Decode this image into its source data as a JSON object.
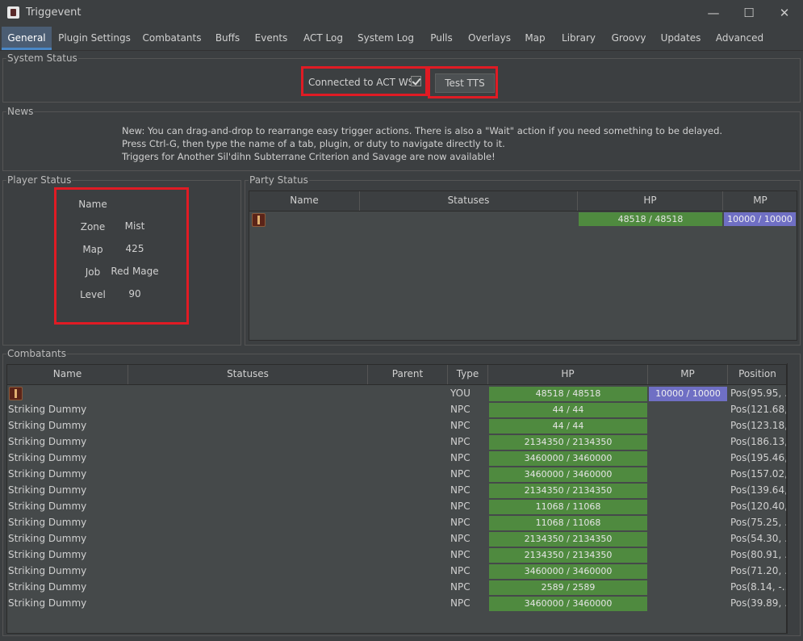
{
  "app": {
    "title": "Triggevent",
    "icon": "app-icon"
  },
  "window_controls": {
    "minimize": "—",
    "maximize": "☐",
    "close": "✕"
  },
  "tabs": [
    "General",
    "Plugin Settings",
    "Combatants",
    "Buffs",
    "Events",
    "ACT Log",
    "System Log",
    "Pulls",
    "Overlays",
    "Map",
    "Library",
    "Groovy",
    "Updates",
    "Advanced"
  ],
  "active_tab": "General",
  "system_status": {
    "title": "System Status",
    "connected_label": "Connected to ACT WS",
    "connected": true,
    "test_tts_label": "Test TTS"
  },
  "news": {
    "title": "News",
    "lines": [
      "New: You can drag-and-drop to rearrange easy trigger actions. There is also a \"Wait\" action if you need something to be delayed.",
      "Press Ctrl-G, then type the name of a tab, plugin, or duty to navigate directly to it.",
      "Triggers for Another Sil'dihn Subterrane Criterion and Savage are now available!"
    ]
  },
  "player_status": {
    "title": "Player Status",
    "rows": [
      {
        "label": "Name",
        "value": ""
      },
      {
        "label": "Zone",
        "value": "Mist"
      },
      {
        "label": "Map",
        "value": "425"
      },
      {
        "label": "Job",
        "value": "Red Mage"
      },
      {
        "label": "Level",
        "value": "90"
      }
    ]
  },
  "party_status": {
    "title": "Party Status",
    "columns": [
      "Name",
      "Statuses",
      "HP",
      "MP"
    ],
    "rows": [
      {
        "name": "",
        "icon": "red-mage-job-icon",
        "statuses": "",
        "hp": "48518 / 48518",
        "hp_fraction": 1.0,
        "mp": "10000 / 10000",
        "mp_fraction": 1.0
      }
    ]
  },
  "combatants": {
    "title": "Combatants",
    "columns": [
      "Name",
      "Statuses",
      "Parent",
      "Type",
      "HP",
      "MP",
      "Position"
    ],
    "rows": [
      {
        "name": "",
        "icon": "red-mage-job-icon",
        "type": "YOU",
        "hp": "48518 / 48518",
        "mp": "10000 / 10000",
        "position": "Pos(95.95, ..."
      },
      {
        "name": "Striking Dummy",
        "type": "NPC",
        "hp": "44 / 44",
        "mp": "",
        "position": "Pos(121.68,..."
      },
      {
        "name": "Striking Dummy",
        "type": "NPC",
        "hp": "44 / 44",
        "mp": "",
        "position": "Pos(123.18,..."
      },
      {
        "name": "Striking Dummy",
        "type": "NPC",
        "hp": "2134350 / 2134350",
        "mp": "",
        "position": "Pos(186.13,..."
      },
      {
        "name": "Striking Dummy",
        "type": "NPC",
        "hp": "3460000 / 3460000",
        "mp": "",
        "position": "Pos(195.46,..."
      },
      {
        "name": "Striking Dummy",
        "type": "NPC",
        "hp": "3460000 / 3460000",
        "mp": "",
        "position": "Pos(157.02,..."
      },
      {
        "name": "Striking Dummy",
        "type": "NPC",
        "hp": "2134350 / 2134350",
        "mp": "",
        "position": "Pos(139.64,..."
      },
      {
        "name": "Striking Dummy",
        "type": "NPC",
        "hp": "11068 / 11068",
        "mp": "",
        "position": "Pos(120.40,..."
      },
      {
        "name": "Striking Dummy",
        "type": "NPC",
        "hp": "11068 / 11068",
        "mp": "",
        "position": "Pos(75.25, ..."
      },
      {
        "name": "Striking Dummy",
        "type": "NPC",
        "hp": "2134350 / 2134350",
        "mp": "",
        "position": "Pos(54.30, ..."
      },
      {
        "name": "Striking Dummy",
        "type": "NPC",
        "hp": "2134350 / 2134350",
        "mp": "",
        "position": "Pos(80.91, ..."
      },
      {
        "name": "Striking Dummy",
        "type": "NPC",
        "hp": "3460000 / 3460000",
        "mp": "",
        "position": "Pos(71.20, ..."
      },
      {
        "name": "Striking Dummy",
        "type": "NPC",
        "hp": "2589 / 2589",
        "mp": "",
        "position": "Pos(8.14, -..."
      },
      {
        "name": "Striking Dummy",
        "type": "NPC",
        "hp": "3460000 / 3460000",
        "mp": "",
        "position": "Pos(39.89, ..."
      }
    ]
  },
  "colors": {
    "accent": "#4a88c7",
    "hp_bar": "#4f8a3f",
    "mp_bar": "#6f6fc4",
    "highlight_box": "#e01b24"
  }
}
